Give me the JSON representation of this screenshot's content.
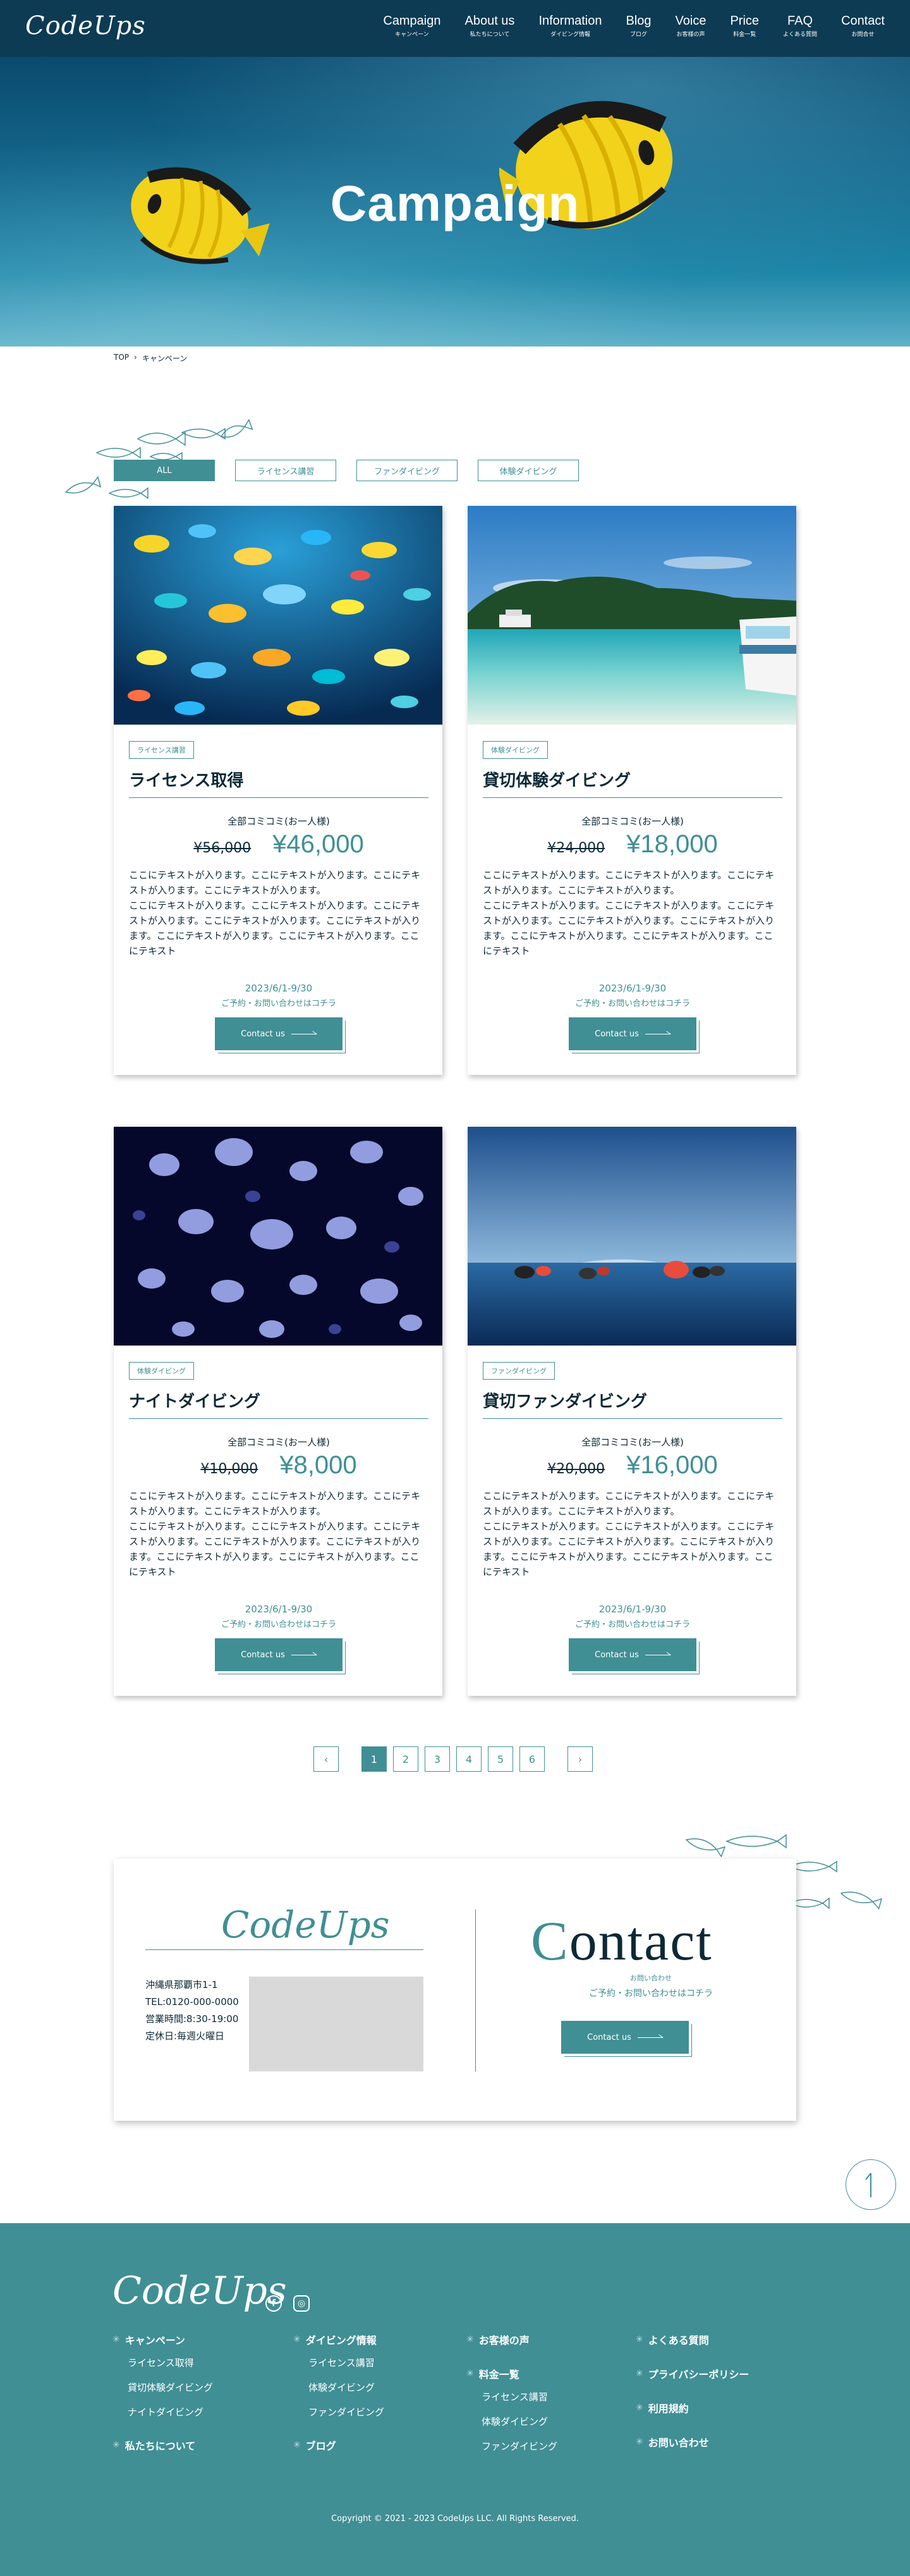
{
  "header": {
    "logo": "CodeUps",
    "nav": [
      {
        "en": "Campaign",
        "ja": "キャンペーン"
      },
      {
        "en": "About us",
        "ja": "私たちについて"
      },
      {
        "en": "Information",
        "ja": "ダイビング情報"
      },
      {
        "en": "Blog",
        "ja": "ブログ"
      },
      {
        "en": "Voice",
        "ja": "お客様の声"
      },
      {
        "en": "Price",
        "ja": "料金一覧"
      },
      {
        "en": "FAQ",
        "ja": "よくある質問"
      },
      {
        "en": "Contact",
        "ja": "お問合せ"
      }
    ]
  },
  "hero": {
    "title": "Campaign"
  },
  "breadcrumb": {
    "home": "TOP",
    "separator": "›",
    "current": "キャンペーン"
  },
  "tabs": [
    "ALL",
    "ライセンス講習",
    "ファンダイビング",
    "体験ダイビング"
  ],
  "cards": [
    {
      "badge": "ライセンス講習",
      "title": "ライセンス取得",
      "price_label": "全部コミコミ(お一人様)",
      "price_old": "¥56,000",
      "price_new": "¥46,000",
      "text": "ここにテキストが入ります。ここにテキストが入ります。ここにテキストが入ります。ここにテキストが入ります。\nここにテキストが入ります。ここにテキストが入ります。ここにテキストが入ります。ここにテキストが入ります。ここにテキストが入ります。ここにテキストが入ります。ここにテキストが入ります。ここにテキスト",
      "period": "2023/6/1-9/30",
      "reserve": "ご予約・お問い合わせはコチラ",
      "button": "Contact us"
    },
    {
      "badge": "体験ダイビング",
      "title": "貸切体験ダイビング",
      "price_label": "全部コミコミ(お一人様)",
      "price_old": "¥24,000",
      "price_new": "¥18,000",
      "text": "ここにテキストが入ります。ここにテキストが入ります。ここにテキストが入ります。ここにテキストが入ります。\nここにテキストが入ります。ここにテキストが入ります。ここにテキストが入ります。ここにテキストが入ります。ここにテキストが入ります。ここにテキストが入ります。ここにテキストが入ります。ここにテキスト",
      "period": "2023/6/1-9/30",
      "reserve": "ご予約・お問い合わせはコチラ",
      "button": "Contact us"
    },
    {
      "badge": "体験ダイビング",
      "title": "ナイトダイビング",
      "price_label": "全部コミコミ(お一人様)",
      "price_old": "¥10,000",
      "price_new": "¥8,000",
      "text": "ここにテキストが入ります。ここにテキストが入ります。ここにテキストが入ります。ここにテキストが入ります。\nここにテキストが入ります。ここにテキストが入ります。ここにテキストが入ります。ここにテキストが入ります。ここにテキストが入ります。ここにテキストが入ります。ここにテキストが入ります。ここにテキスト",
      "period": "2023/6/1-9/30",
      "reserve": "ご予約・お問い合わせはコチラ",
      "button": "Contact us"
    },
    {
      "badge": "ファンダイビング",
      "title": "貸切ファンダイビング",
      "price_label": "全部コミコミ(お一人様)",
      "price_old": "¥20,000",
      "price_new": "¥16,000",
      "text": "ここにテキストが入ります。ここにテキストが入ります。ここにテキストが入ります。ここにテキストが入ります。\nここにテキストが入ります。ここにテキストが入ります。ここにテキストが入ります。ここにテキストが入ります。ここにテキストが入ります。ここにテキストが入ります。ここにテキストが入ります。ここにテキスト",
      "period": "2023/6/1-9/30",
      "reserve": "ご予約・お問い合わせはコチラ",
      "button": "Contact us"
    }
  ],
  "pagination": {
    "prev": "‹",
    "pages": [
      "1",
      "2",
      "3",
      "4",
      "5",
      "6"
    ],
    "next": "›",
    "current": "1"
  },
  "contact": {
    "logo": "CodeUps",
    "address": "沖縄県那覇市1-1",
    "tel": "TEL:0120-000-0000",
    "hours": "営業時間:8:30-19:00",
    "holiday": "定休日:毎週火曜日",
    "title_first": "C",
    "title_rest": "ontact",
    "sub_ja": "お問い合わせ",
    "sub_text": "ご予約・お問い合わせはコチラ",
    "button": "Contact us"
  },
  "footer": {
    "logo": "CodeUps",
    "social": {
      "facebook": "f",
      "instagram": "◎"
    },
    "columns": [
      [
        {
          "head": "キャンペーン",
          "items": [
            "ライセンス取得",
            "貸切体験ダイビング",
            "ナイトダイビング"
          ]
        },
        {
          "head": "私たちについて",
          "items": []
        }
      ],
      [
        {
          "head": "ダイビング情報",
          "items": [
            "ライセンス講習",
            "体験ダイビング",
            "ファンダイビング"
          ]
        },
        {
          "head": "ブログ",
          "items": []
        }
      ],
      [
        {
          "head": "お客様の声",
          "items": []
        },
        {
          "head": "料金一覧",
          "items": [
            "ライセンス講習",
            "体験ダイビング",
            "ファンダイビング"
          ]
        }
      ],
      [
        {
          "head": "よくある質問",
          "items": []
        },
        {
          "head": "プライバシーポリシー",
          "items": []
        },
        {
          "head": "利用規約",
          "items": []
        },
        {
          "head": "お問い合わせ",
          "items": []
        }
      ]
    ],
    "copyright": "Copyright © 2021 - 2023 CodeUps LLC. All Rights Reserved."
  },
  "colors": {
    "primary": "#408f95",
    "header_bg": "#0d3b54",
    "text": "#0d2936"
  },
  "icons": {
    "breadcrumb": "chevron-right-icon",
    "page_top": "arrow-up-icon",
    "footer_bullet": "asterisk-icon"
  }
}
